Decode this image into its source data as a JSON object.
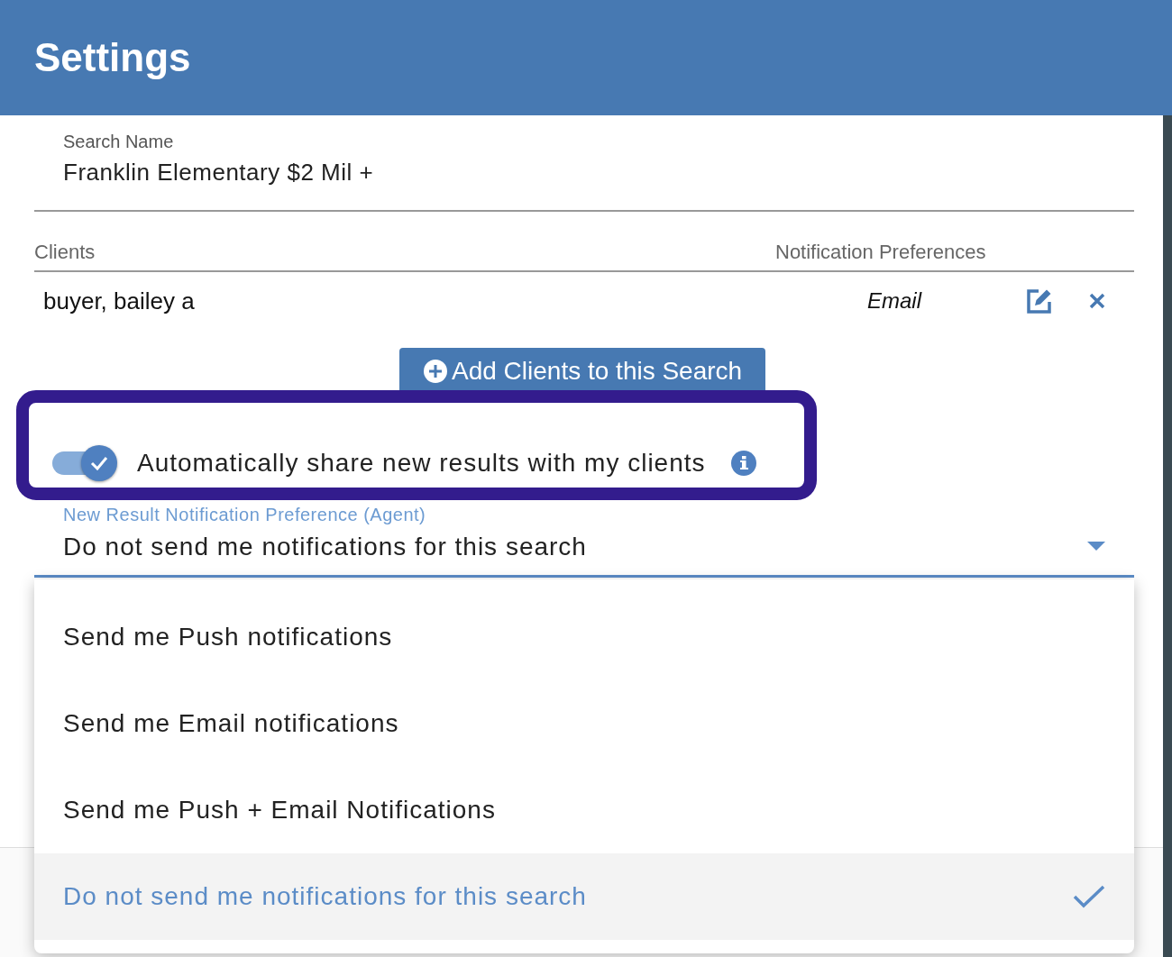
{
  "header": {
    "title": "Settings"
  },
  "search_name": {
    "label": "Search Name",
    "value": "Franklin Elementary $2 Mil +"
  },
  "clients_table": {
    "columns": [
      "Clients",
      "Notification Preferences"
    ],
    "rows": [
      {
        "name": "buyer, bailey a",
        "preference": "Email"
      }
    ]
  },
  "add_clients_button": {
    "label": "Add Clients to this Search"
  },
  "auto_share": {
    "label": "Automatically share new results with my clients",
    "on": true
  },
  "notification_select": {
    "label": "New Result Notification Preference (Agent)",
    "value": "Do not send me notifications for this search",
    "expanded": true,
    "options": [
      {
        "label": "Send me Push notifications",
        "selected": false
      },
      {
        "label": "Send me Email notifications",
        "selected": false
      },
      {
        "label": "Send me Push + Email Notifications",
        "selected": false
      },
      {
        "label": "Do not send me notifications for this search",
        "selected": true
      }
    ]
  }
}
